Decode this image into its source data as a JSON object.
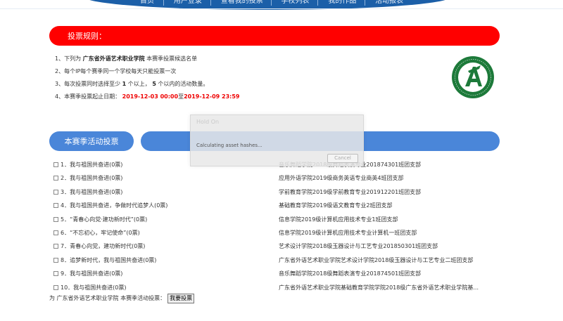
{
  "nav": {
    "items": [
      "首页",
      "用户登录",
      "查看我的投票",
      "学校列表",
      "我的作品",
      "活动报表"
    ]
  },
  "rules": {
    "title": "投票规则：",
    "line1": {
      "prefix": "1、下列为 ",
      "school": "广东省外语艺术职业学院",
      "suffix": " 本赛季投票候选名单"
    },
    "line2": "2、每个IP每个赛季同一个学校每天只能投票一次",
    "line3": {
      "prefix": "3、每次投票同时选择至少 ",
      "min": "1",
      "mid": " 个以上， ",
      "max": "5",
      "suffix": " 个以内的活动数量。"
    },
    "line4": {
      "prefix": "4、本赛季投票起止日期： ",
      "start": "2019-12-03 00:00",
      "to": "至",
      "end": "2019-12-09 23:59"
    }
  },
  "logo": {
    "icon": "school-logo-emblem",
    "color": "#1d7a3a"
  },
  "activity": {
    "tab_label": "本赛季活动投票"
  },
  "dialog": {
    "title": "Hold On",
    "message": "Calculating asset hashes...",
    "cancel": "Cancel"
  },
  "candidates": [
    {
      "name": "1．我与祖国共奋进(0票)",
      "org": "音乐舞蹈学院2018级舞蹈表演专业201874301班团支部"
    },
    {
      "name": "2．我与祖国共奋进(0票)",
      "org": "应用外语学院2019级商务英语专业商英4班团支部"
    },
    {
      "name": "3．我与祖国共奋进(0票)",
      "org": "学前教育学院2019级学前教育专业201912201班团支部"
    },
    {
      "name": "4．我与祖国共奋进，争做时代追梦人(0票)",
      "org": "基础教育学院2019级语文教育专业2班团支部"
    },
    {
      "name": "5．“青春心向党·建功新时代”(0票)",
      "org": "信息学院2019级计算机应用技术专业1班团支部"
    },
    {
      "name": "6．“不忘初心，牢记使命”(0票)",
      "org": "信息学院2019级计算机应用技术专业计算机一班团支部"
    },
    {
      "name": "7．青春心向党，建功新时代(0票)",
      "org": "艺术设计学院2018级玉器设计与工艺专业201850301班团支部"
    },
    {
      "name": "8．追梦新时代，我与祖国共奋进(0票)",
      "org": "广东省外语艺术职业学院艺术设计学院2018级玉器设计与工艺专业二班团支部"
    },
    {
      "name": "9．我与祖国共奋进(0票)",
      "org": "音乐舞蹈学院2018级舞蹈表演专业201874501班团支部"
    },
    {
      "name": "10．我与祖国共奋进(0票)",
      "org": "广东省外语艺术职业学院基础教育学院学院2018级广东省外语艺术职业学院基..."
    }
  ],
  "footer": {
    "text": "为 广东省外语艺术职业学院 本赛季活动投票：",
    "button": "我要投票"
  }
}
